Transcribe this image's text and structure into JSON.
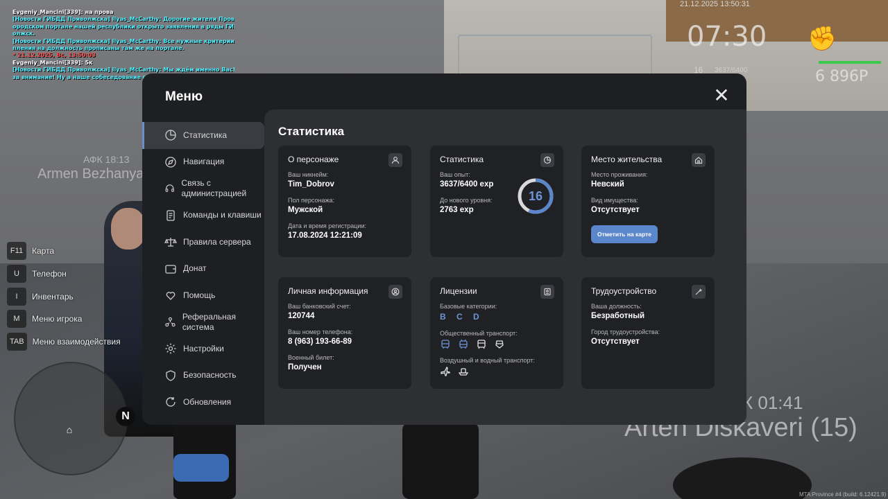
{
  "chat": [
    {
      "color": "white",
      "text": "Evgeniy_Mancini[339]: на прова"
    },
    {
      "color": "cyan",
      "text": "[Новости ГИБДД Приволжска] Ilyas_McCarthy: Дорогие жители Провинции! На г"
    },
    {
      "color": "cyan",
      "text": "ородском портале нашей республики открыто заявления в ряды ГИБДД г.Прив"
    },
    {
      "color": "cyan",
      "text": "олжск."
    },
    {
      "color": "cyan",
      "text": "[Новости ГИБДД Приволжска] Ilyas_McCarthy: Все нужные критерии, для посту"
    },
    {
      "color": "cyan",
      "text": "пления на должность прописаны там же на портале."
    },
    {
      "color": "red",
      "text": "* 21.12.2025, Вс, 13:50:03"
    },
    {
      "color": "white",
      "text": "Evgeniy_Mancini[339]: 5к"
    },
    {
      "color": "cyan",
      "text": "[Новости ГИБДД Приволжска] Ilyas_McCarthy: Мы ждём именно Вас! Спасибо"
    },
    {
      "color": "cyan",
      "text": " за внимание! Ну а наше собеседование продолжается!"
    }
  ],
  "hud": {
    "date": "21.12.2025 13:50:31",
    "time": "07:30",
    "level": "16",
    "exp": "3637/6400",
    "money": "6 896Р",
    "fist_icon": "fist-icon"
  },
  "world_labels": {
    "afk_left": "АФК 18:13",
    "name_left": "Armen Bezhanya",
    "afk_right": "К 01:41",
    "name_right": "Arten Diskaveri (15)"
  },
  "hotkeys": [
    {
      "key": "F11",
      "label": "Карта"
    },
    {
      "key": "U",
      "label": "Телефон"
    },
    {
      "key": "I",
      "label": "Инвентарь"
    },
    {
      "key": "M",
      "label": "Меню игрока"
    },
    {
      "key": "TAB",
      "label": "Меню взаимодействия"
    }
  ],
  "radar": {
    "north": "N"
  },
  "build": "MTA:Province #4 (build: 6.12421.9)",
  "menu": {
    "title": "Меню",
    "close": "✕",
    "nav": [
      {
        "label": "Статистика",
        "icon": "pie-chart-icon",
        "active": true
      },
      {
        "label": "Навигация",
        "icon": "compass-icon"
      },
      {
        "label": "Связь с администрацией",
        "icon": "headset-icon"
      },
      {
        "label": "Команды и клавиши",
        "icon": "document-icon"
      },
      {
        "label": "Правила сервера",
        "icon": "scales-icon"
      },
      {
        "label": "Донат",
        "icon": "wallet-icon"
      },
      {
        "label": "Помощь",
        "icon": "heart-hand-icon"
      },
      {
        "label": "Реферальная система",
        "icon": "referral-icon"
      },
      {
        "label": "Настройки",
        "icon": "gear-icon"
      },
      {
        "label": "Безопасность",
        "icon": "shield-icon"
      },
      {
        "label": "Обновления",
        "icon": "refresh-icon"
      }
    ],
    "content_title": "Статистика",
    "cards": {
      "character": {
        "title": "О персонаже",
        "icon": "user-icon",
        "nick_label": "Ваш никнейм:",
        "nick": "Tim_Dobrov",
        "gender_label": "Пол персонажа:",
        "gender": "Мужской",
        "reg_label": "Дата и время регистрации:",
        "reg": "17.08.2024 12:21:09"
      },
      "stats": {
        "title": "Статистика",
        "icon": "pie-chart-icon",
        "exp_label": "Ваш опыт:",
        "exp": "3637/6400 exp",
        "next_label": "До нового уровня:",
        "next": "2763 exp",
        "level": "16",
        "progress": 0.568
      },
      "residence": {
        "title": "Место жительства",
        "icon": "house-icon",
        "place_label": "Место проживания:",
        "place": "Невский",
        "property_label": "Вид имущества:",
        "property": "Отсутствует",
        "button": "Отметить на карте"
      },
      "personal": {
        "title": "Личная информация",
        "icon": "id-badge-icon",
        "bank_label": "Ваш банковский счет:",
        "bank": "120744",
        "phone_label": "Ваш номер телефона:",
        "phone": "8 (963) 193-66-89",
        "military_label": "Военный билет:",
        "military": "Получен"
      },
      "licenses": {
        "title": "Лицензии",
        "icon": "license-icon",
        "base_label": "Базовые категории:",
        "base": "B C D",
        "public_label": "Общественный транспорт:",
        "air_label": "Воздушный и водный транспорт:"
      },
      "employment": {
        "title": "Трудоустройство",
        "icon": "tools-icon",
        "position_label": "Ваша должность:",
        "position": "Безработный",
        "city_label": "Город трудоустройства:",
        "city": "Отсутствует"
      }
    }
  }
}
